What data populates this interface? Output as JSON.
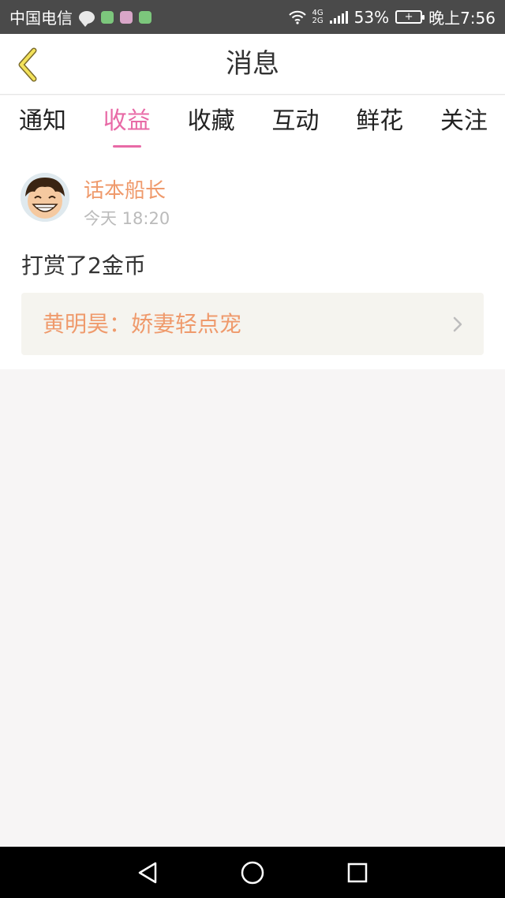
{
  "status_bar": {
    "carrier": "中国电信",
    "battery_percent": "53%",
    "time": "晚上7:56",
    "network_top": "4G",
    "network_bottom": "2G"
  },
  "header": {
    "title": "消息"
  },
  "tabs": [
    {
      "label": "通知",
      "active": false
    },
    {
      "label": "收益",
      "active": true
    },
    {
      "label": "收藏",
      "active": false
    },
    {
      "label": "互动",
      "active": false
    },
    {
      "label": "鲜花",
      "active": false
    },
    {
      "label": "关注",
      "active": false
    }
  ],
  "messages": [
    {
      "username": "话本船长",
      "time": "今天 18:20",
      "text": "打赏了2金币",
      "link": "黄明昊：娇妻轻点宠"
    }
  ],
  "colors": {
    "accent_pink": "#e86aa6",
    "username_orange": "#ef9a6c",
    "card_bg": "#f5f4ef",
    "page_bg": "#f7f5f5"
  }
}
